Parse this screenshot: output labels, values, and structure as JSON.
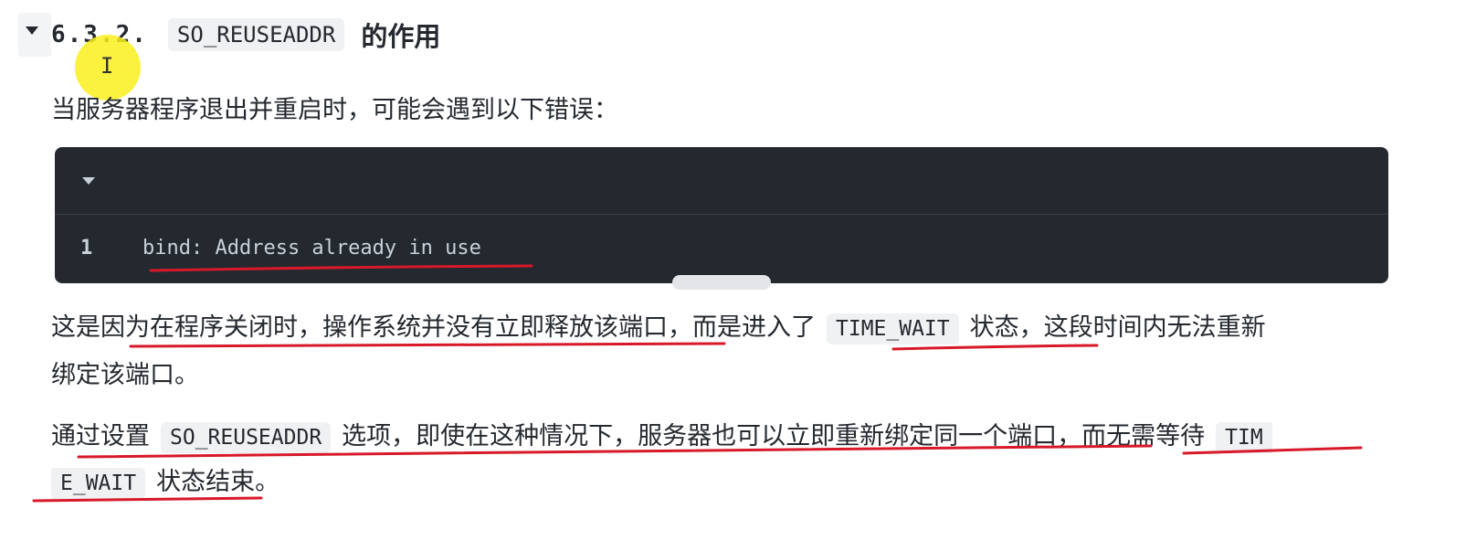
{
  "heading": {
    "number": "6.3.2.",
    "code": "SO_REUSEADDR",
    "text": "的作用"
  },
  "paragraph1": "当服务器程序退出并重启时，可能会遇到以下错误：",
  "codeblock": {
    "line_number": "1",
    "code": "bind: Address already in use"
  },
  "paragraph2": {
    "text_before": "这是因为在程序关闭时，操作系统并没有立即释放该端口，而是进入了",
    "code": "TIME_WAIT",
    "text_after": "状态，这段时间内无法重新",
    "line2": "绑定该端口。"
  },
  "paragraph3": {
    "text_before": "通过设置",
    "code": "SO_REUSEADDR",
    "text_middle": "选项，即使在这种情况下，服务器也可以立即重新绑定同一个端口，而无需等待",
    "code_wrap_start": "TIM",
    "code_wrap_end": "E_WAIT",
    "text_after": "状态结束。"
  },
  "colors": {
    "annotation_red": "#d7192a",
    "cursor_yellow": "#f8ec1e",
    "code_bg": "#24282f"
  }
}
